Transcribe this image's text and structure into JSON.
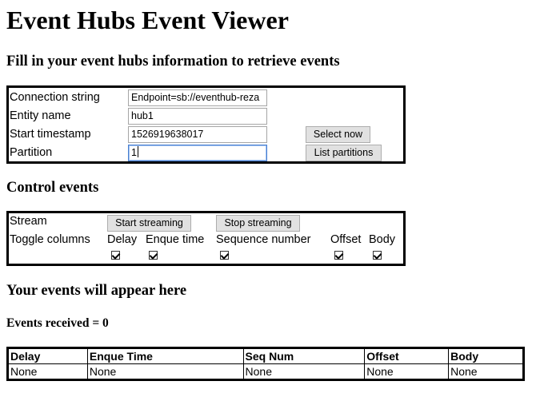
{
  "page": {
    "title": "Event Hubs Event Viewer",
    "subtitle": "Fill in your event hubs information to retrieve events"
  },
  "connection_form": {
    "fields": [
      {
        "label": "Connection string",
        "value": "Endpoint=sb://eventhub-reza"
      },
      {
        "label": "Entity name",
        "value": "hub1"
      },
      {
        "label": "Start timestamp",
        "value": "1526919638017"
      },
      {
        "label": "Partition",
        "value": "1"
      }
    ],
    "select_now_label": "Select now",
    "list_partitions_label": "List partitions"
  },
  "control": {
    "heading": "Control events",
    "stream_label": "Stream",
    "start_label": "Start streaming",
    "stop_label": "Stop streaming",
    "toggle_label": "Toggle columns",
    "toggles": [
      {
        "label": "Delay",
        "checked": true
      },
      {
        "label": "Enque time",
        "checked": true
      },
      {
        "label": "Sequence number",
        "checked": true
      },
      {
        "label": "Offset",
        "checked": true
      },
      {
        "label": "Body",
        "checked": true
      }
    ]
  },
  "events": {
    "heading": "Your events will appear here",
    "count_text": "Events received = 0",
    "columns": [
      "Delay",
      "Enque Time",
      "Seq Num",
      "Offset",
      "Body"
    ],
    "rows": [
      [
        "None",
        "None",
        "None",
        "None",
        "None"
      ]
    ]
  }
}
